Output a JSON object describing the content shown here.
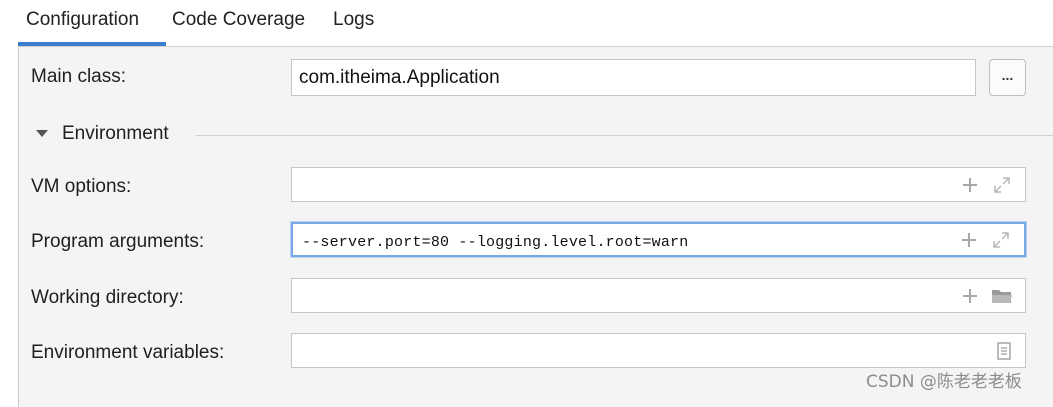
{
  "tabs": [
    {
      "label": "Configuration",
      "active": true
    },
    {
      "label": "Code Coverage",
      "active": false
    },
    {
      "label": "Logs",
      "active": false
    }
  ],
  "colors": {
    "accent": "#3d7dd1",
    "panel_bg": "#f4f4f4",
    "field_focus": "#7aa8e4"
  },
  "main_class": {
    "label": "Main class:",
    "value": "com.itheima.Application",
    "browse_label": "..."
  },
  "environment": {
    "title": "Environment",
    "expanded": true,
    "vm_options": {
      "label": "VM options:",
      "value": "",
      "icons": [
        "plus-icon",
        "expand-icon"
      ]
    },
    "program_arguments": {
      "label": "Program arguments:",
      "value": "--server.port=80 --logging.level.root=warn",
      "focused": true,
      "icons": [
        "plus-icon",
        "expand-icon"
      ]
    },
    "working_directory": {
      "label": "Working directory:",
      "value": "",
      "icons": [
        "plus-icon",
        "folder-icon"
      ]
    },
    "environment_variables": {
      "label": "Environment variables:",
      "value": "",
      "icons": [
        "document-icon"
      ]
    }
  },
  "watermark": "CSDN @陈老老老板"
}
